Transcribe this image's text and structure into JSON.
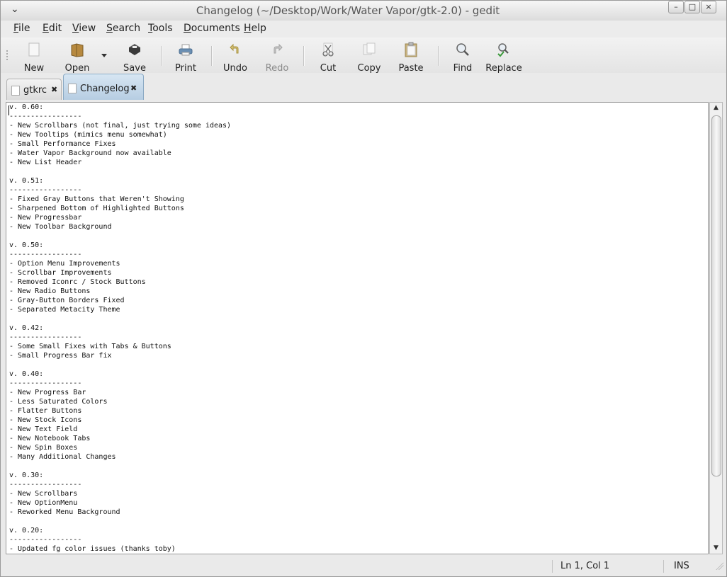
{
  "window": {
    "title": "Changelog (~/Desktop/Work/Water Vapor/gtk-2.0) - gedit",
    "controls": [
      "–",
      "□",
      "×"
    ]
  },
  "menubar": {
    "items": [
      {
        "label": "File",
        "mnemonic": "F",
        "rest": "ile"
      },
      {
        "label": "Edit",
        "mnemonic": "E",
        "rest": "dit"
      },
      {
        "label": "View",
        "mnemonic": "V",
        "rest": "iew"
      },
      {
        "label": "Search",
        "mnemonic": "S",
        "rest": "earch"
      },
      {
        "label": "Tools",
        "mnemonic": "T",
        "rest": "ools"
      },
      {
        "label": "Documents",
        "mnemonic": "D",
        "rest": "ocuments"
      },
      {
        "label": "Help",
        "mnemonic": "H",
        "rest": "elp"
      }
    ]
  },
  "toolbar": {
    "new": "New",
    "open": "Open",
    "save": "Save",
    "print": "Print",
    "undo": "Undo",
    "redo": "Redo",
    "cut": "Cut",
    "copy": "Copy",
    "paste": "Paste",
    "find": "Find",
    "replace": "Replace"
  },
  "tabs": [
    {
      "label": "gtkrc",
      "active": false
    },
    {
      "label": "Changelog",
      "active": true
    }
  ],
  "editor": {
    "content": "v. 0.60:\n-----------------\n- New Scrollbars (not final, just trying some ideas)\n- New Tooltips (mimics menu somewhat)\n- Small Performance Fixes\n- Water Vapor Background now available\n- New List Header\n\nv. 0.51:\n-----------------\n- Fixed Gray Buttons that Weren't Showing\n- Sharpened Bottom of Highlighted Buttons\n- New Progressbar\n- New Toolbar Background\n\nv. 0.50:\n-----------------\n- Option Menu Improvements\n- Scrollbar Improvements\n- Removed Iconrc / Stock Buttons\n- New Radio Buttons\n- Gray-Button Borders Fixed\n- Separated Metacity Theme\n\nv. 0.42:\n-----------------\n- Some Small Fixes with Tabs & Buttons\n- Small Progress Bar fix\n\nv. 0.40:\n-----------------\n- New Progress Bar\n- Less Saturated Colors\n- Flatter Buttons\n- New Stock Icons\n- New Text Field\n- New Notebook Tabs\n- New Spin Boxes\n- Many Additional Changes\n\nv. 0.30:\n-----------------\n- New Scrollbars\n- New OptionMenu\n- Reworked Menu Background\n\nv. 0.20:\n-----------------\n- Updated fg color issues (thanks toby)"
  },
  "statusbar": {
    "position": "Ln 1, Col 1",
    "mode": "INS"
  },
  "colors": {
    "active_tab": "#b6cde2",
    "editor_bg": "#ffffff",
    "chrome_bg": "#eaeaea"
  }
}
